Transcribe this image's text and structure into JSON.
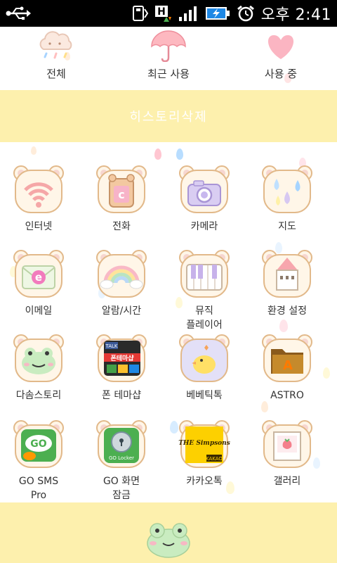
{
  "status_bar": {
    "icons": [
      "usb-icon",
      "sd-card-icon",
      "h-data-icon",
      "signal-icon",
      "battery-charging-icon",
      "alarm-clock-icon"
    ],
    "time": "오후 2:41"
  },
  "tabs": [
    {
      "label": "전체",
      "icon": "cloud-icon"
    },
    {
      "label": "최근 사용",
      "icon": "umbrella-icon"
    },
    {
      "label": "사용 중",
      "icon": "heart-icon"
    }
  ],
  "history_delete_label": "히스토리삭제",
  "apps": [
    {
      "label": "인터넷",
      "icon": "wifi-icon"
    },
    {
      "label": "전화",
      "icon": "phone-bear-icon"
    },
    {
      "label": "카메라",
      "icon": "camera-icon"
    },
    {
      "label": "지도",
      "icon": "raindrops-icon"
    },
    {
      "label": "이메일",
      "icon": "envelope-icon"
    },
    {
      "label": "알람/시간",
      "icon": "rainbow-icon"
    },
    {
      "label": "뮤직\n플레이어",
      "icon": "piano-icon"
    },
    {
      "label": "환경 설정",
      "icon": "house-icon"
    },
    {
      "label": "다솜스토리",
      "icon": "frog-icon"
    },
    {
      "label": "폰 테마샵",
      "icon": "theme-shop-icon"
    },
    {
      "label": "베베틱톡",
      "icon": "chick-icon"
    },
    {
      "label": "ASTRO",
      "icon": "folder-icon"
    },
    {
      "label": "GO SMS\nPro",
      "icon": "go-sms-icon"
    },
    {
      "label": "GO 화면\n잠금",
      "icon": "go-locker-icon"
    },
    {
      "label": "카카오톡",
      "icon": "kakao-icon"
    },
    {
      "label": "갤러리",
      "icon": "gallery-icon"
    }
  ],
  "icon_texts": {
    "phone_letter": "c",
    "email_letter": "e",
    "theme_talk": "TALK",
    "theme_shop": "폰테마샵",
    "go_sms": "GO",
    "go_locker": "GO Locker",
    "simpsons": "THE Simpsons",
    "kakao": "KAKAO",
    "astro": "A"
  },
  "colors": {
    "banner": "#fdf0ad",
    "bear_fill": "#fff6e8",
    "bear_outline": "#e2b98a",
    "bear_ear": "#f7c9c9"
  }
}
